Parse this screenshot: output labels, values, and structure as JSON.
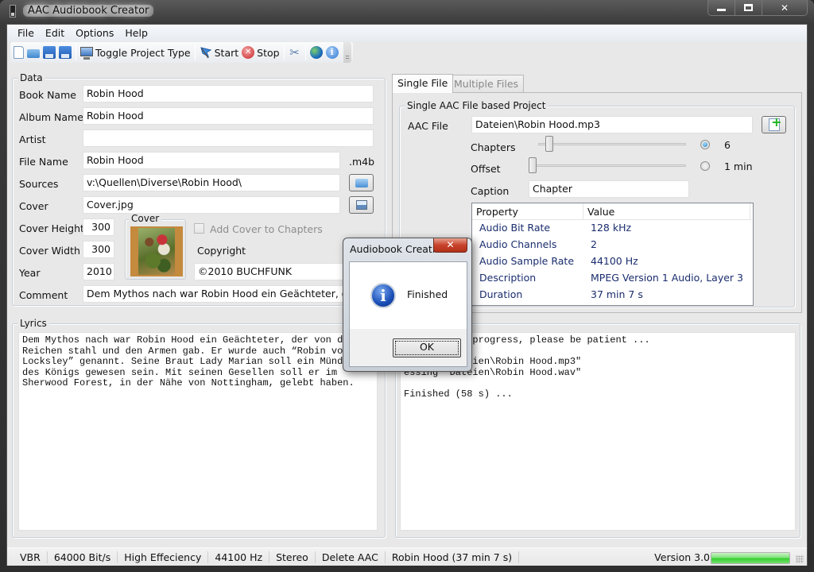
{
  "window": {
    "title": "AAC Audiobook Creator",
    "controls": {
      "minimize": "minimize",
      "maximize": "maximize",
      "close": "✕"
    }
  },
  "menu": [
    "File",
    "Edit",
    "Options",
    "Help"
  ],
  "toolbar": {
    "items": [
      {
        "icon": "new-document-icon"
      },
      {
        "icon": "open-folder-icon"
      },
      {
        "icon": "save-icon"
      },
      {
        "icon": "save-as-icon"
      },
      {
        "icon": "monitor-icon",
        "label": "Toggle Project Type"
      },
      {
        "icon": "flag-icon",
        "label": "Start"
      },
      {
        "icon": "stop-icon",
        "label": "Stop"
      },
      {
        "icon": "tools-icon"
      },
      {
        "icon": "globe-icon"
      },
      {
        "icon": "info-icon"
      }
    ]
  },
  "data_group": {
    "title": "Data",
    "book_name": {
      "label": "Book Name",
      "value": "Robin Hood"
    },
    "album_name": {
      "label": "Album Name",
      "value": "Robin Hood"
    },
    "artist": {
      "label": "Artist",
      "value": ""
    },
    "file_name": {
      "label": "File Name",
      "value": "Robin Hood",
      "ext": ".m4b"
    },
    "sources": {
      "label": "Sources",
      "value": "v:\\Quellen\\Diverse\\Robin Hood\\"
    },
    "cover": {
      "label": "Cover",
      "value": "Cover.jpg"
    },
    "cover_height": {
      "label": "Cover Height",
      "value": "300"
    },
    "cover_width": {
      "label": "Cover Width",
      "value": "300"
    },
    "year": {
      "label": "Year",
      "value": "2010"
    },
    "cover_preview_title": "Cover",
    "add_cover_to_chapters": {
      "label": "Add Cover to Chapters",
      "checked": false,
      "enabled": false
    },
    "copyright": {
      "label": "Copyright",
      "value": "©2010 BUCHFUNK"
    },
    "comment": {
      "label": "Comment",
      "value": "Dem Mythos nach war Robin Hood ein Geächteter, der von d"
    }
  },
  "lyrics": {
    "title": "Lyrics",
    "text": "Dem Mythos nach war Robin Hood ein Geächteter, der von d\nReichen stahl und den Armen gab. Er wurde auch “Robin vo\nLocksley” genannt. Seine Braut Lady Marian soll ein Münd\ndes Königs gewesen sein. Mit seinen Gesellen soll er im \nSherwood Forest, in der Nähe von Nottingham, gelebt haben."
  },
  "tabs": [
    {
      "label": "Single File",
      "active": true
    },
    {
      "label": "Multiple Files",
      "active": false
    }
  ],
  "single_file": {
    "group_title": "Single AAC File based Project",
    "aac_file": {
      "label": "AAC File",
      "value": "Dateien\\Robin Hood.mp3"
    },
    "chapters": {
      "label": "Chapters",
      "value": "6",
      "slider_fraction": 0.08,
      "selected": true
    },
    "offset": {
      "label": "Offset",
      "value": "1 min",
      "slider_fraction": 0.0,
      "selected": false
    },
    "caption": {
      "label": "Caption",
      "value": "Chapter"
    },
    "properties": {
      "columns": [
        "Property",
        "Value"
      ],
      "rows": [
        [
          "Audio Bit Rate",
          "128 kHz"
        ],
        [
          "Audio Channels",
          "2"
        ],
        [
          "Audio Sample Rate",
          "44100 Hz"
        ],
        [
          "Description",
          "MPEG Version 1 Audio, Layer 3"
        ],
        [
          "Duration",
          "37 min 7 s"
        ]
      ]
    }
  },
  "log": {
    "text": "ation is in progress, please be patient ...\n\nessing \"Dateien\\Robin Hood.mp3\"\nessing \"Dateien\\Robin Hood.wav\"\n\nFinished (58 s) ..."
  },
  "status_bar": {
    "items": [
      "VBR",
      "64000 Bit/s",
      "High Effeciency",
      "44100 Hz",
      "Stereo",
      "Delete AAC",
      "Robin Hood  (37 min 7 s)"
    ],
    "version": "Version 3.0",
    "progress_percent": 100,
    "progress_color": "#37cf31"
  },
  "dialog": {
    "title": "Audiobook Creati...",
    "message": "Finished",
    "ok_label": "OK",
    "close_label": "✕"
  }
}
